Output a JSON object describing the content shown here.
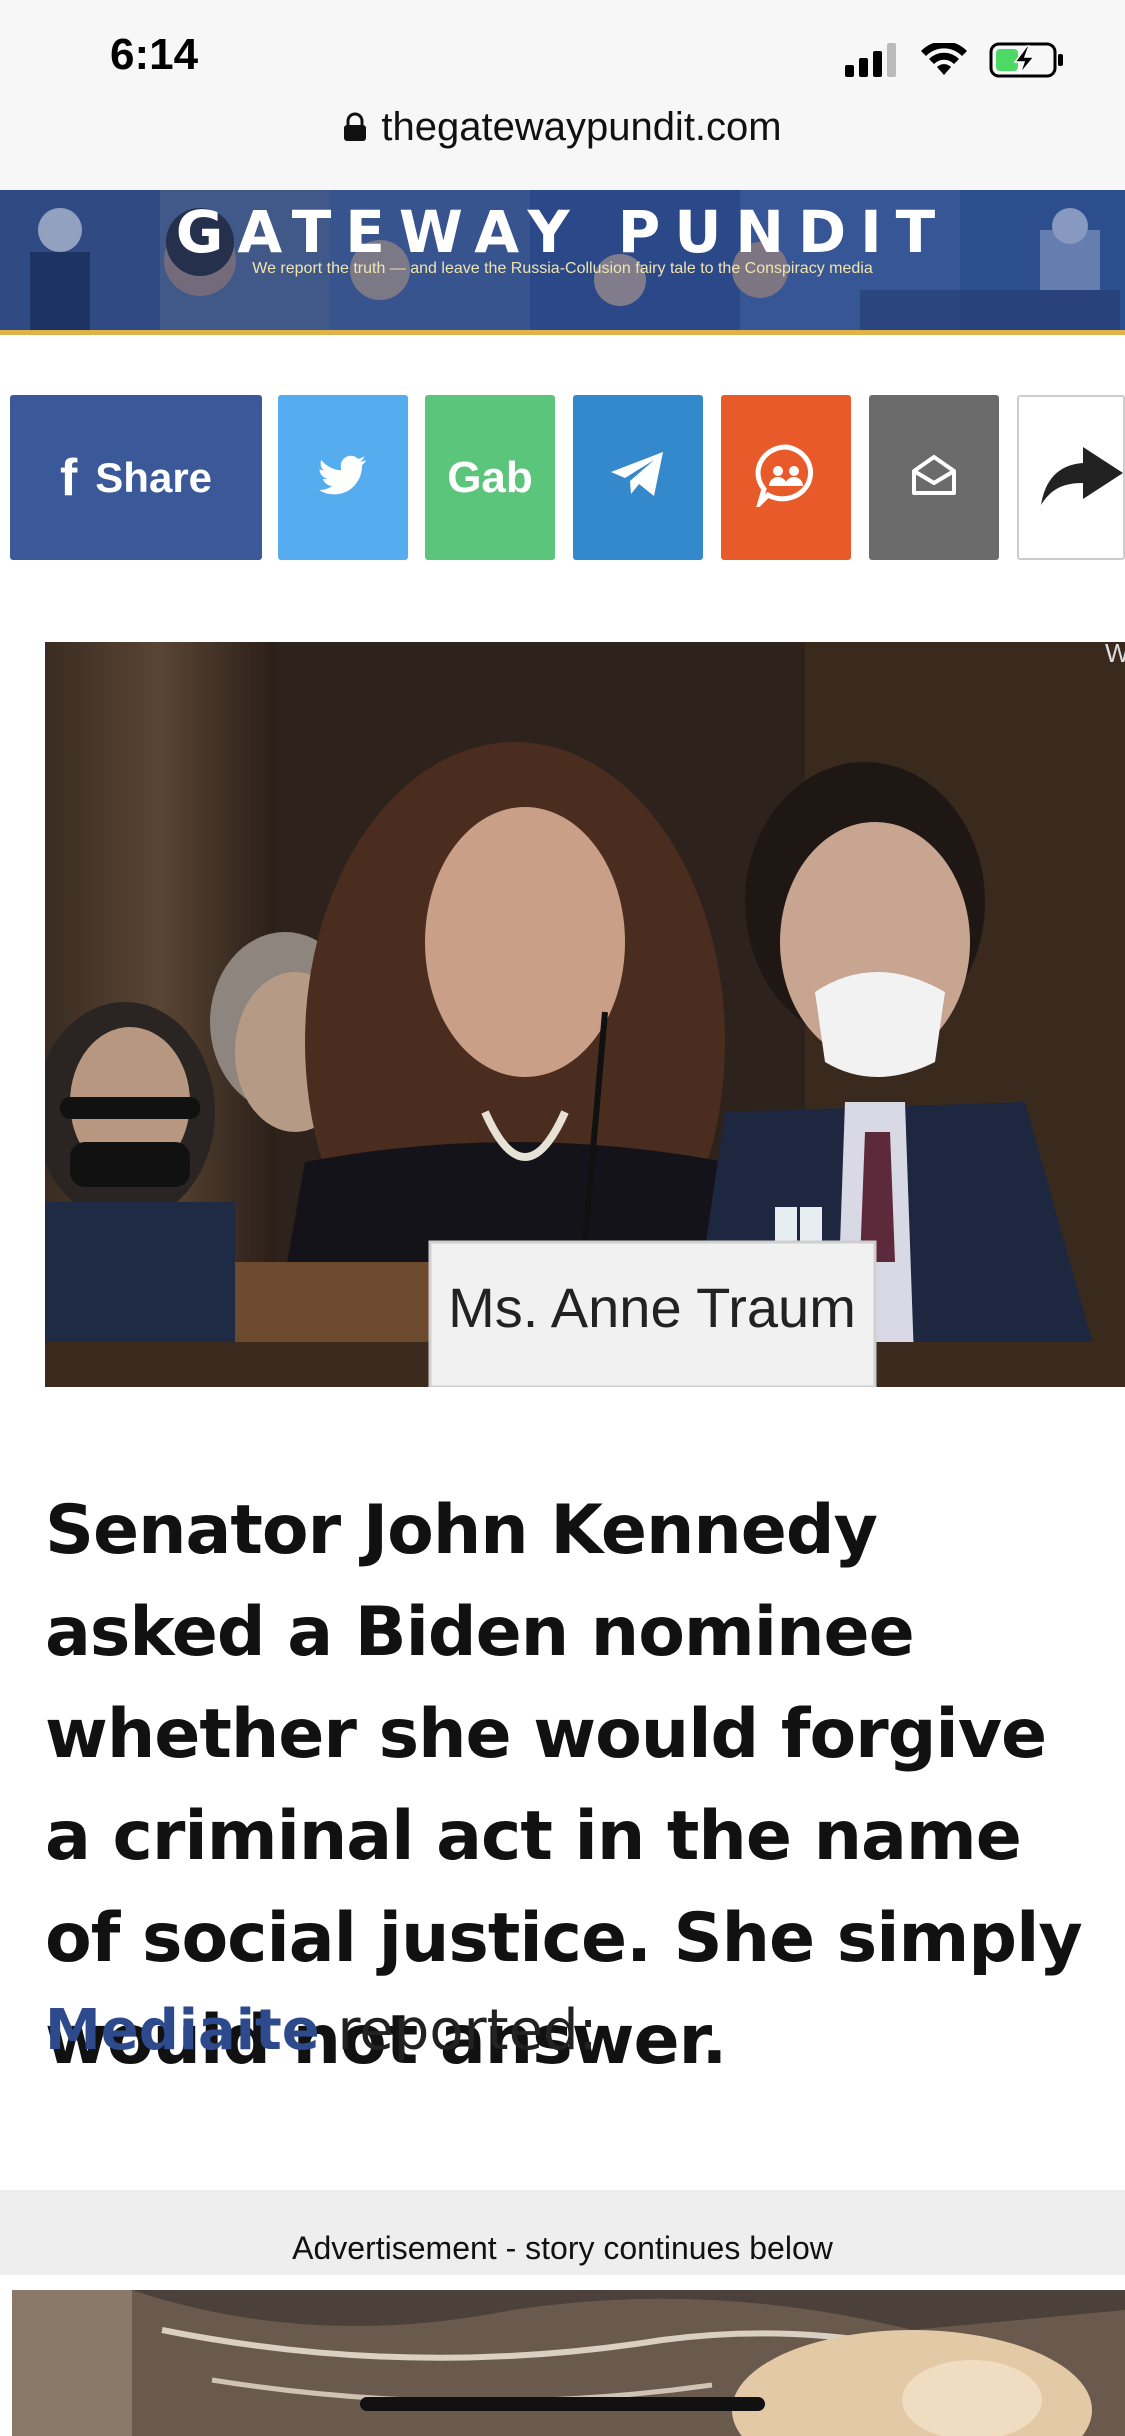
{
  "status_bar": {
    "time": "6:14",
    "signal_icon": "cellular-signal-icon",
    "wifi_icon": "wifi-icon",
    "battery_icon": "battery-charging-icon"
  },
  "browser": {
    "url": "thegatewaypundit.com",
    "lock_icon": "lock-icon"
  },
  "banner": {
    "title": "GATEWAY PUNDIT",
    "tagline": "We report the truth — and leave the Russia-Collusion fairy tale to the Conspiracy media"
  },
  "share_buttons": {
    "facebook_label": "Share",
    "gab_label": "Gab",
    "colors": {
      "facebook": "#3b5998",
      "twitter": "#55acee",
      "gab": "#5bc57c",
      "telegram": "#3389cc",
      "comments": "#e85a2a",
      "email": "#6b6b6b",
      "more": "#ffffff"
    }
  },
  "article": {
    "photo_placard": "Ms. Anne Traum",
    "photo_corner_text": "Wa",
    "headline": "Senator John Kennedy asked a Biden nominee whether she would forgive a criminal act in the name of social justice.  She simply would not answer.",
    "source_link": "Mediaite",
    "source_suffix": " reported:"
  },
  "ad": {
    "label": "Advertisement - story continues below"
  }
}
